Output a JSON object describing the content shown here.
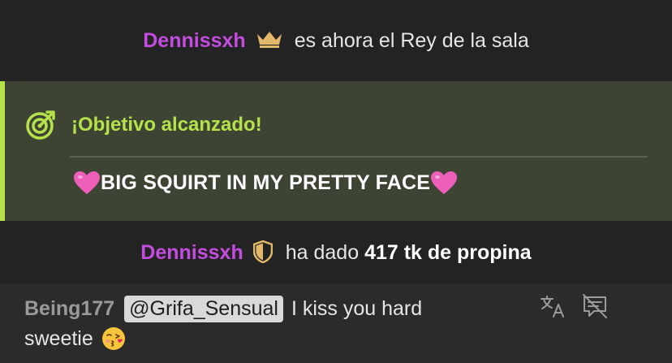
{
  "king_notice": {
    "username": "Dennissxh",
    "text": "es ahora el Rey de la sala",
    "badge_icon": "crown-icon",
    "username_color": "#c44ce0",
    "badge_color": "#e2b86a"
  },
  "goal": {
    "icon": "target-icon",
    "title": "¡Objetivo alcanzado!",
    "text": "BIG SQUIRT IN MY PRETTY FACE",
    "leading_emoji": "pink-heart-icon",
    "trailing_emoji": "pink-heart-icon",
    "accent_color": "#b5e24a",
    "background_color": "#3d4434"
  },
  "tip_notice": {
    "username": "Dennissxh",
    "badge_icon": "shield-icon",
    "text_prefix": "ha dado",
    "amount": "417 tk de propina"
  },
  "message": {
    "username": "Being177",
    "mention": "@Grifa_Sensual",
    "text_line1": "I kiss you hard",
    "text_line2": "sweetie",
    "emoji": "face-blowing-kiss-icon",
    "actions": [
      "translate-icon",
      "hide-message-icon"
    ]
  }
}
